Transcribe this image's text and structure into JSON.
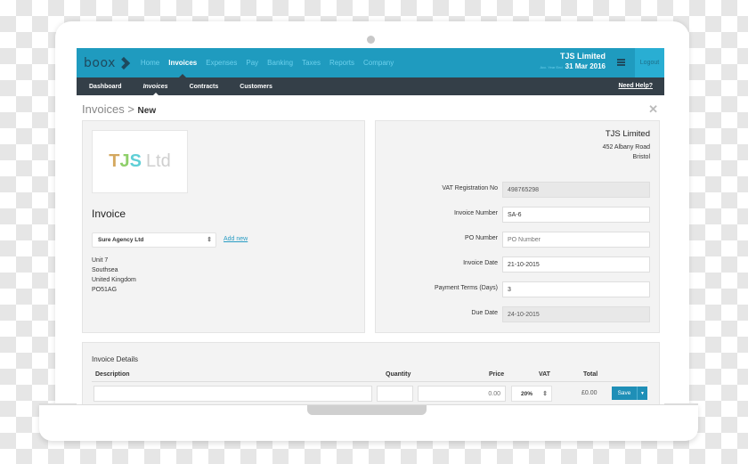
{
  "app": {
    "logo_text": "boox",
    "main_nav": [
      {
        "label": "Home",
        "active": false
      },
      {
        "label": "Invoices",
        "active": true
      },
      {
        "label": "Expenses",
        "active": false
      },
      {
        "label": "Pay",
        "active": false
      },
      {
        "label": "Banking",
        "active": false
      },
      {
        "label": "Taxes",
        "active": false
      },
      {
        "label": "Reports",
        "active": false
      },
      {
        "label": "Company",
        "active": false
      }
    ],
    "company_name": "TJS Limited",
    "year_end_label": "Acc. Year End",
    "year_end_date": "31 Mar 2016",
    "menu_icon": "hamburger-icon",
    "logout_label": "Logout",
    "sub_nav": [
      {
        "label": "Dashboard",
        "active": false
      },
      {
        "label": "Invoices",
        "active": true
      },
      {
        "label": "Contracts",
        "active": false
      },
      {
        "label": "Customers",
        "active": false
      }
    ],
    "need_help_label": "Need Help?",
    "colors": {
      "topnav": "#1f9bbf",
      "subnav": "#343f48",
      "accent": "#1f8fb7"
    }
  },
  "page": {
    "breadcrumb_parent": "Invoices",
    "breadcrumb_separator": ">",
    "breadcrumb_current": "New",
    "close_icon": "✕"
  },
  "customer_panel": {
    "logo": {
      "t": "T",
      "j": "J",
      "s": "S",
      "suffix": "Ltd"
    },
    "title": "Invoice",
    "customer_selected": "Sure Agency Ltd",
    "add_new_label": "Add new",
    "address_lines": [
      "Unit 7",
      "Southsea",
      "United Kingdom",
      "PO51AG"
    ]
  },
  "seller_panel": {
    "name": "TJS Limited",
    "address_lines": [
      "452 Albany Road",
      "Bristol"
    ],
    "fields": [
      {
        "label": "VAT Registration No",
        "value": "498765298",
        "placeholder": "",
        "readonly": true
      },
      {
        "label": "Invoice Number",
        "value": "SA-6",
        "placeholder": "",
        "readonly": false
      },
      {
        "label": "PO Number",
        "value": "",
        "placeholder": "PO Number",
        "readonly": false
      },
      {
        "label": "Invoice Date",
        "value": "21-10-2015",
        "placeholder": "",
        "readonly": false
      },
      {
        "label": "Payment Terms (Days)",
        "value": "3",
        "placeholder": "",
        "readonly": false
      },
      {
        "label": "Due Date",
        "value": "24-10-2015",
        "placeholder": "",
        "readonly": true
      }
    ]
  },
  "details": {
    "title": "Invoice Details",
    "columns": {
      "description": "Description",
      "quantity": "Quantity",
      "price": "Price",
      "vat": "VAT",
      "total": "Total"
    },
    "line": {
      "description": "",
      "quantity": "",
      "price_placeholder": "0.00",
      "vat": "20%",
      "total": "£0.00"
    },
    "save_label": "Save"
  }
}
